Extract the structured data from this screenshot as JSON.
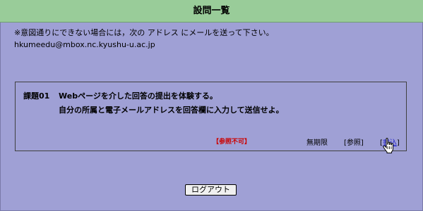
{
  "header": {
    "title": "設問一覧"
  },
  "notice": {
    "text": "※意図通りにできない場合には，次の アドレス にメールを送って下さい。",
    "email": "hkumeedu@mbox.nc.kyushu-u.ac.jp"
  },
  "assignment": {
    "id": "課題01",
    "description_line1": "Webページを介した回答の提出を体験する。",
    "description_line2": "自分の所属と電子メールアドレスを回答欄に入力して送信せよ。",
    "status": "【参照不可】",
    "deadline": "無期限",
    "reference": {
      "open": "[",
      "label": "参照",
      "close": "]"
    },
    "write": {
      "open": "[",
      "label": "書込",
      "close": "]"
    }
  },
  "logout_label": "ログアウト",
  "colors": {
    "background": "#9fa0d5",
    "header": "#99cc99",
    "status_red": "#cc0000",
    "link_blue": "#2020cc"
  }
}
